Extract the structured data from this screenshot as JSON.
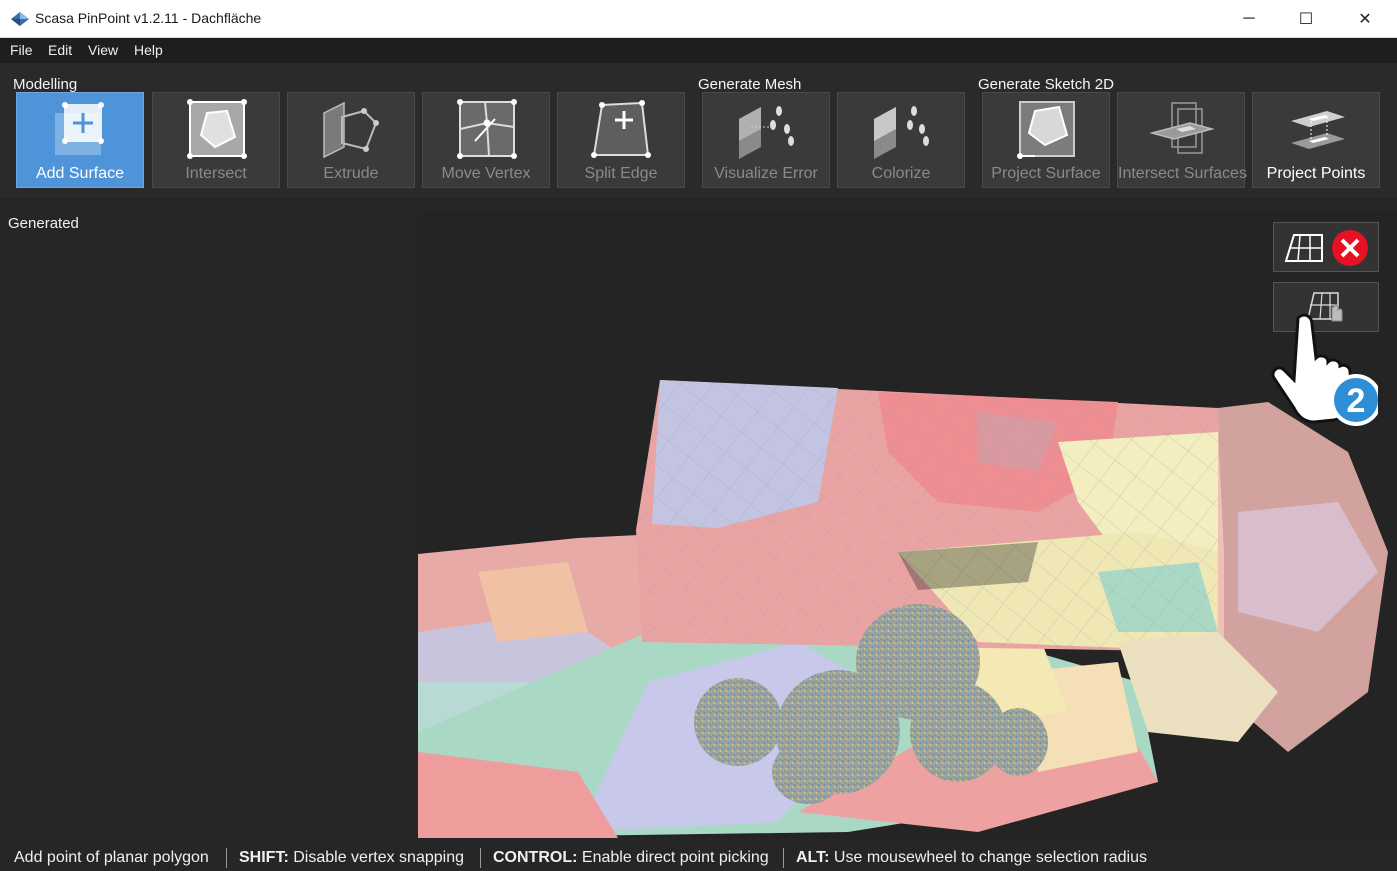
{
  "window": {
    "title": "Scasa PinPoint v1.2.11 - Dachfläche",
    "controls": {
      "minimize": "─",
      "maximize": "☐",
      "close": "✕"
    }
  },
  "menu": [
    "File",
    "Edit",
    "View",
    "Help"
  ],
  "ribbon": {
    "groups": {
      "modelling": "Modelling",
      "generate_mesh": "Generate Mesh",
      "generate_sketch": "Generate Sketch 2D"
    },
    "tools": [
      {
        "label": "Add Surface",
        "icon": "add-surface-icon",
        "state": "active"
      },
      {
        "label": "Intersect",
        "icon": "intersect-icon",
        "state": "disabled"
      },
      {
        "label": "Extrude",
        "icon": "extrude-icon",
        "state": "disabled"
      },
      {
        "label": "Move Vertex",
        "icon": "move-vertex-icon",
        "state": "disabled"
      },
      {
        "label": "Split Edge",
        "icon": "split-edge-icon",
        "state": "disabled"
      },
      {
        "label": "Visualize Error",
        "icon": "visualize-error-icon",
        "state": "disabled"
      },
      {
        "label": "Colorize",
        "icon": "colorize-icon",
        "state": "disabled"
      },
      {
        "label": "Project Surface",
        "icon": "project-surface-icon",
        "state": "disabled"
      },
      {
        "label": "Intersect Surfaces",
        "icon": "intersect-surfaces-icon",
        "state": "disabled"
      },
      {
        "label": "Project Points",
        "icon": "project-points-icon",
        "state": "enabled"
      }
    ]
  },
  "left_panel": {
    "title": "Generated"
  },
  "viewport": {
    "overlay_buttons": [
      {
        "icon": "grid-cancel-icon"
      },
      {
        "icon": "grid-pick-icon"
      }
    ],
    "hint_badge": "2"
  },
  "status": {
    "hint": "Add point of planar polygon",
    "shift_key": "SHIFT:",
    "shift_text": "Disable vertex snapping",
    "control_key": "CONTROL:",
    "control_text": "Enable direct point picking",
    "alt_key": "ALT:",
    "alt_text": "Use mousewheel to change selection radius"
  },
  "colors": {
    "accent": "#4f93d8",
    "background": "#262626",
    "close_red": "#e81123"
  }
}
